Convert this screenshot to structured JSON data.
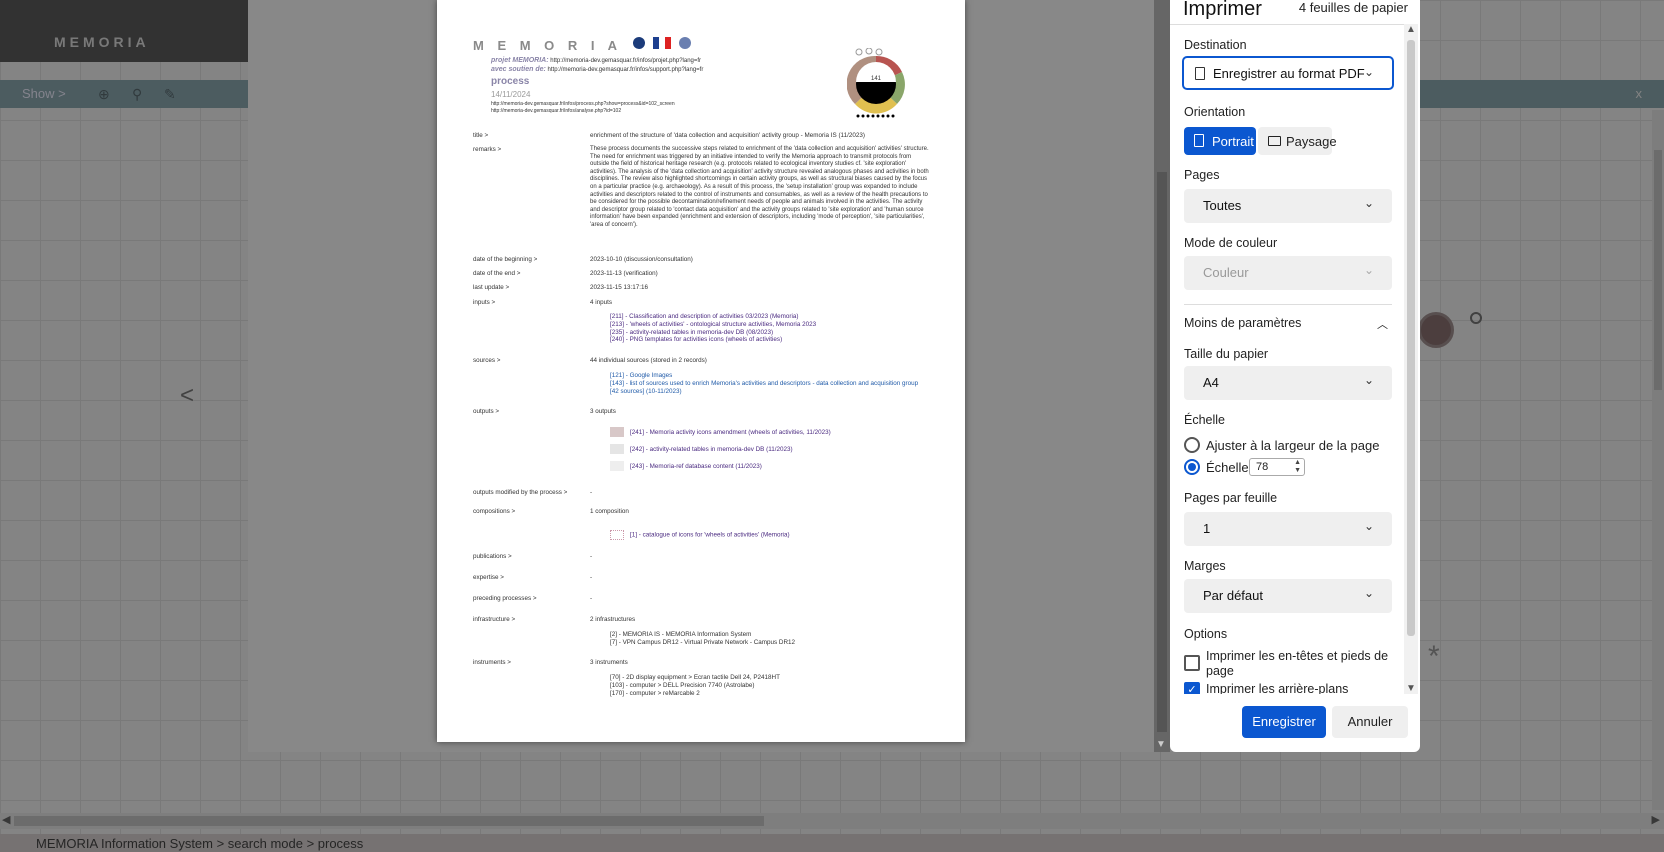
{
  "app": {
    "logo": "MEMORIA",
    "show_label": "Show >",
    "close_label": "x",
    "back_arrow": "<",
    "status_path": "MEMORIA  Information System  >  search mode > process"
  },
  "print": {
    "title": "Imprimer",
    "sheets": "4 feuilles de papier",
    "destination_label": "Destination",
    "destination_value": "Enregistrer au format PDF",
    "orientation_label": "Orientation",
    "orientation_portrait": "Portrait",
    "orientation_landscape": "Paysage",
    "pages_label": "Pages",
    "pages_value": "Toutes",
    "color_label": "Mode de couleur",
    "color_value": "Couleur",
    "less_settings": "Moins de paramètres",
    "paper_label": "Taille du papier",
    "paper_value": "A4",
    "scale_label": "Échelle",
    "scale_fit": "Ajuster à la largeur de la page",
    "scale_custom": "Échelle",
    "scale_value": "78",
    "pps_label": "Pages par feuille",
    "pps_value": "1",
    "margins_label": "Marges",
    "margins_value": "Par défaut",
    "options_label": "Options",
    "opt_headers": "Imprimer les en-têtes et pieds de page",
    "opt_backgrounds": "Imprimer les arrière-plans",
    "save_button": "Enregistrer",
    "cancel_button": "Annuler",
    "accent": "#0b57d0"
  },
  "doc": {
    "brand": "M E M O R I A",
    "sub1_label": "projet MEMORIA:",
    "sub1_url": "http://memoria-dev.gemasquar.fr/infos/projet.php?lang=fr",
    "sub2_label": "avec soutien de:",
    "sub2_url": "http://memoria-dev.gemasquar.fr/infos/support.php?lang=fr",
    "type": "process",
    "date": "14/11/2024",
    "url1": "http://memoria-dev.gemasquar.fr/infos/process.php?show=process&id=102_screen",
    "url2": "http://memoria-dev.gemasquar.fr/infos/analyse.php?id=102",
    "wheel_label": "141",
    "fields": {
      "title_k": "title >",
      "title_v": "enrichment of the structure of 'data collection and acquisition' activity group - Memoria IS (11/2023)",
      "remarks_k": "remarks >",
      "remarks_v": "These process documents the successive steps related to enrichment of the 'data collection and acquisition' activities' structure. The need for enrichment was triggered by an initiative intended to verify the Memoria approach to transmit protocols from outside the field of historical heritage research (e.g. protocols related to ecological inventory studies cf. 'site exploration' activities). The analysis of the 'data collection and acquisition' activity structure revealed analogous phases and activities in both disciplines. The review also highlighted shortcomings in certain activity groups, as well as structural biases caused by the focus on a particular practice (e.g. archaeology). As a result of this process, the 'setup installation' group was expanded to include activities and descriptors related to the control of instruments and consumables, as well as a review of the health precautions to be considered for the possible decontamination/refinement needs of people and animals involved in the activities. The activity and descriptor group related to 'contact data acquisition' and the activity groups related to 'site exploration' and 'human source information' have been expanded (enrichment and extension of descriptors, including 'mode of perception', 'site particularities', 'area of concern').",
      "begin_k": "date of the beginning >",
      "begin_v": "2023-10-10 (discussion/consultation)",
      "end_k": "date of the end >",
      "end_v": "2023-11-13 (verification)",
      "update_k": "last update >",
      "update_v": "2023-11-15 13:17:16",
      "inputs_k": "inputs >",
      "inputs_v": "4 inputs",
      "inputs": [
        "[211] - Classification and description of activities 03/2023 (Memoria)",
        "[213] - 'wheels of activities' - ontological structure activities, Memoria 2023",
        "[235] - activity-related tables in memoria-dev DB (08/2023)",
        "[240] - PNG templates for activities icons (wheels of activities)"
      ],
      "sources_k": "sources >",
      "sources_v": "44 individual sources (stored in 2 records)",
      "sources": [
        "[121] - Google Images",
        "[143] - list of sources used to enrich Memoria's activities and descriptors - data collection and acquisition group [42 sources] (10-11/2023)"
      ],
      "outputs_k": "outputs >",
      "outputs_v": "3 outputs",
      "outputs": [
        "[241] - Memoria activity icons amendment (wheels of activities, 11/2023)",
        "[242] - activity-related tables in memoria-dev DB (11/2023)",
        "[243] - Memoria-ref database content (11/2023)"
      ],
      "modified_k": "outputs modified by the process >",
      "modified_v": "-",
      "compositions_k": "compositions >",
      "compositions_v": "1 composition",
      "composition_item": "[1] - catalogue of icons for 'wheels of activities' (Memoria)",
      "publications_k": "publications >",
      "publications_v": "-",
      "expertise_k": "expertise >",
      "expertise_v": "-",
      "preceding_k": "preceding processes >",
      "preceding_v": "-",
      "infra_k": "infrastructure >",
      "infra_v": "2 infrastructures",
      "infra": [
        "[2] - MEMORIA IS - MEMORIA Information System",
        "[7] - VPN Campus DR12 - Virtual Private Network - Campus DR12"
      ],
      "instr_k": "instruments >",
      "instr_v": "3 instruments",
      "instr": [
        "[70] - 2D display equipment > Ecran tactile Dell 24, P2418HT",
        "[103] - computer > DELL Precision 7740 (Astrolabe)",
        "[170] - computer > reMarcable 2"
      ]
    }
  }
}
